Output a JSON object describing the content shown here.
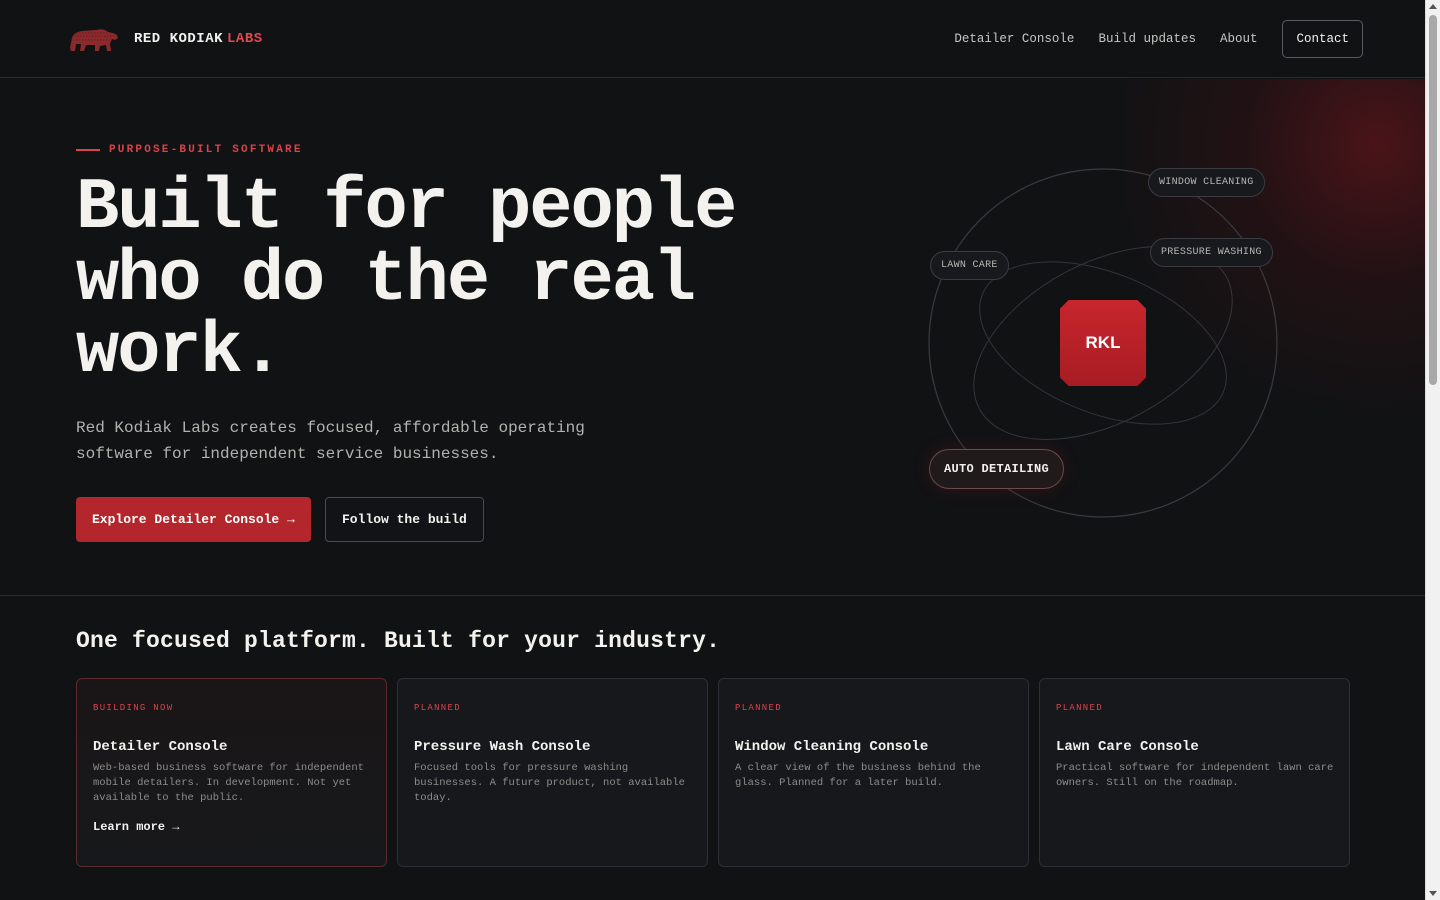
{
  "brand": {
    "name": "RED KODIAK",
    "accent": "LABS",
    "logo_icon": "bear-icon"
  },
  "nav": {
    "items": [
      "Detailer Console",
      "Build updates",
      "About"
    ],
    "contact": "Contact"
  },
  "hero": {
    "eyebrow": "PURPOSE-BUILT SOFTWARE",
    "headline_lines": [
      "Built for people",
      "who do the real",
      "work."
    ],
    "subtext": "Red Kodiak Labs creates focused, affordable operating software for independent service businesses.",
    "primary_button": "Explore Detailer Console →",
    "secondary_button": "Follow the build"
  },
  "orbit": {
    "center": "RKL",
    "chips": {
      "window": "WINDOW CLEANING",
      "pressure": "PRESSURE WASHING",
      "lawn": "LAWN CARE",
      "auto": "AUTO DETAILING"
    }
  },
  "platform": {
    "title": "One focused platform. Built for your industry.",
    "cards": [
      {
        "status": "BUILDING NOW",
        "title": "Detailer Console",
        "desc": "Web-based business software for independent mobile detailers. In development. Not yet available to the public.",
        "link": "Learn more →"
      },
      {
        "status": "PLANNED",
        "title": "Pressure Wash Console",
        "desc": "Focused tools for pressure washing businesses. A future product, not available today."
      },
      {
        "status": "PLANNED",
        "title": "Window Cleaning Console",
        "desc": "A clear view of the business behind the glass. Planned for a later build."
      },
      {
        "status": "PLANNED",
        "title": "Lawn Care Console",
        "desc": "Practical software for independent lawn care owners. Still on the roadmap."
      }
    ]
  },
  "colors": {
    "accent": "#b3262b",
    "accent_text": "#d9434a",
    "background": "#111214"
  }
}
